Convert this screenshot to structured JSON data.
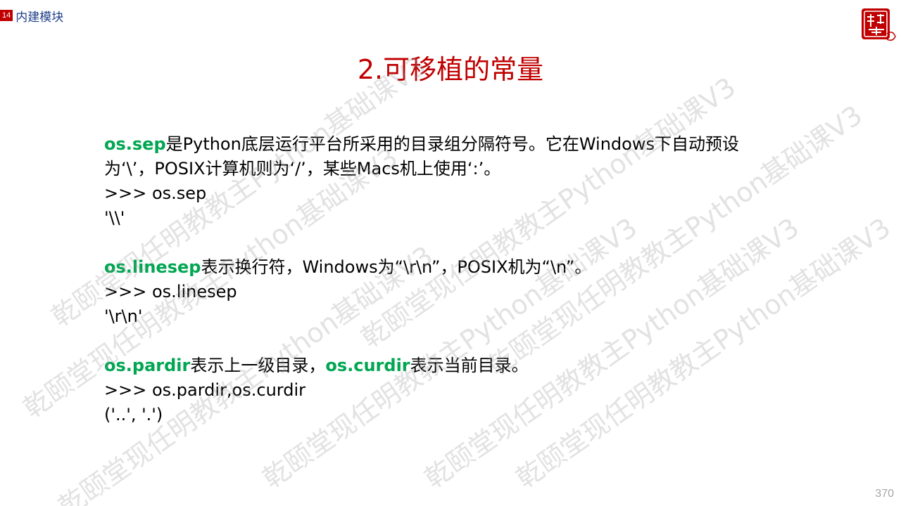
{
  "header": {
    "page_badge": "14",
    "section_title": "内建模块"
  },
  "slide": {
    "title": "2.可移植的常量",
    "blocks": [
      {
        "keyword": "os.sep",
        "description": "是Python底层运行平台所采用的目录组分隔符号。它在Windows下自动预设为‘\\’，POSIX计算机则为‘/’，某些Macs机上使用‘:’。",
        "code": ">>> os.sep",
        "output": "'\\\\'"
      },
      {
        "keyword": "os.linesep",
        "description": "表示换行符，Windows为“\\r\\n”，POSIX机为“\\n”。",
        "code": ">>> os.linesep",
        "output": "'\\r\\n'"
      },
      {
        "keyword": "os.pardir",
        "description": "表示上一级目录，",
        "keyword2": "os.curdir",
        "description2": "表示当前目录。",
        "code": ">>> os.pardir,os.curdir",
        "output": "('..', '.')"
      }
    ]
  },
  "watermark_text": "乾颐堂现任明教教主Python基础课V3",
  "page_number": "370",
  "colors": {
    "title": "#c00000",
    "keyword": "#00a651",
    "section_title": "#1f3f8a",
    "badge": "#c00000"
  }
}
